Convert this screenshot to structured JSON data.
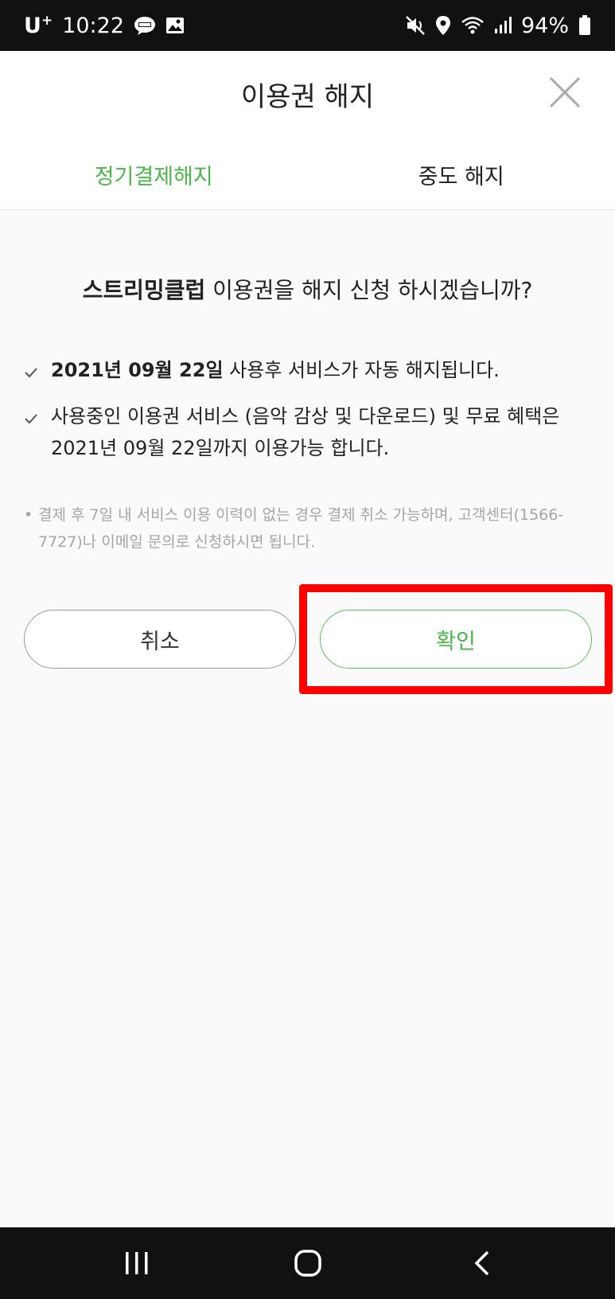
{
  "status_bar": {
    "carrier": "U",
    "carrier_sup": "+",
    "time": "10:22",
    "battery": "94%"
  },
  "header": {
    "title": "이용권 해지",
    "tabs": [
      {
        "label": "정기결제해지",
        "active": true
      },
      {
        "label": "중도 해지",
        "active": false
      }
    ]
  },
  "content": {
    "question_bold": "스트리밍클럽",
    "question_rest": " 이용권을 해지 신청 하시겠습니까?",
    "items": [
      {
        "bold": "2021년 09월 22일",
        "text": " 사용후 서비스가 자동 해지됩니다."
      },
      {
        "bold": "",
        "text": "사용중인 이용권 서비스 (음악 감상 및 다운로드) 및 무료 혜택은 2021년 09월 22일까지 이용가능 합니다."
      }
    ],
    "note": "결제 후 7일 내 서비스 이용 이력이 없는 경우 결제 취소 가능하며, 고객센터(1566-7727)나 이메일 문의로 신청하시면 됩니다."
  },
  "buttons": {
    "cancel": "취소",
    "confirm": "확인"
  },
  "colors": {
    "accent": "#4cb64a",
    "highlight": "#ff0000"
  }
}
